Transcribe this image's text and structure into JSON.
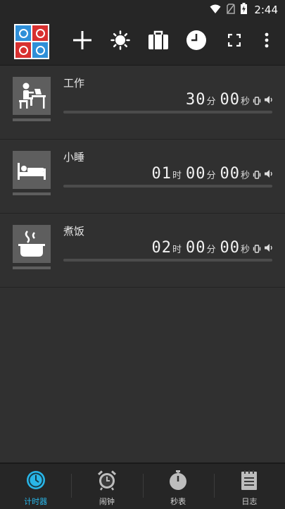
{
  "status_bar": {
    "time": "2:44",
    "icons": [
      "wifi-icon",
      "no-sim-icon",
      "battery-charging-icon"
    ]
  },
  "toolbar": {
    "app_logo": "stopwatch-alarm-logo",
    "buttons": [
      "add-icon",
      "brightness-icon",
      "briefcase-icon",
      "clock-icon",
      "fullscreen-icon",
      "more-vert-icon"
    ]
  },
  "timers": [
    {
      "name": "工作",
      "icon": "desk-worker-icon",
      "h": null,
      "m": "30",
      "s": "00",
      "progress": 0.0
    },
    {
      "name": "小睡",
      "icon": "bed-icon",
      "h": "01",
      "m": "00",
      "s": "00",
      "progress": 0.0
    },
    {
      "name": "煮饭",
      "icon": "cooking-pot-icon",
      "h": "02",
      "m": "00",
      "s": "00",
      "progress": 0.0
    }
  ],
  "units": {
    "hour": "时",
    "minute": "分",
    "second": "秒"
  },
  "bottom_nav": {
    "items": [
      {
        "label": "计时器",
        "icon": "timer-icon",
        "active": true
      },
      {
        "label": "闹钟",
        "icon": "alarm-clock-icon",
        "active": false
      },
      {
        "label": "秒表",
        "icon": "stopwatch-icon",
        "active": false
      },
      {
        "label": "日志",
        "icon": "notepad-icon",
        "active": false
      }
    ]
  },
  "colors": {
    "accent": "#29b6e8",
    "background": "#303030",
    "bar": "#262626"
  }
}
